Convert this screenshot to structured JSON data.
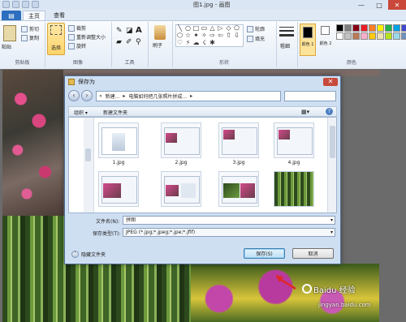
{
  "window": {
    "title": "图1.jpg - 画图",
    "controls": [
      "—",
      "□",
      "✕"
    ]
  },
  "tabs": {
    "home": "主页",
    "view": "查看"
  },
  "ribbon": {
    "clipboard": {
      "paste": "粘贴",
      "cut": "剪切",
      "copy": "复制",
      "label": "剪贴板"
    },
    "image": {
      "select": "选择",
      "crop": "裁剪",
      "resize": "重新调整大小",
      "rotate": "旋转",
      "label": "图像"
    },
    "tools": {
      "label": "工具"
    },
    "brushes": {
      "label": "刷子"
    },
    "shapes": {
      "outline": "轮廓",
      "fill": "填充",
      "label": "形状",
      "glyphs": [
        "╲",
        "○",
        "□",
        "▭",
        "△",
        "▷",
        "◇",
        "⬠",
        "⬡",
        "☆",
        "✦",
        "✧",
        "⇨",
        "⇦",
        "⇧",
        "⇩",
        "♡",
        "⚡",
        "☁",
        "☇",
        "✱"
      ]
    },
    "size": {
      "label": "粗细"
    },
    "colors": {
      "color1": "颜色 1",
      "color2": "颜色 2",
      "label": "颜色",
      "palette": [
        "#000000",
        "#7f7f7f",
        "#880015",
        "#ed1c24",
        "#ff7f27",
        "#fff200",
        "#22b14c",
        "#00a2e8",
        "#3f48cc",
        "#a349a4",
        "#ffffff",
        "#c3c3c3",
        "#b97a57",
        "#ffaec9",
        "#ffc90e",
        "#efe4b0",
        "#b5e61d",
        "#99d9ea",
        "#7092be",
        "#c8bfe7"
      ]
    }
  },
  "dialog": {
    "title": "保存为",
    "path": [
      "«",
      "新建...",
      "▸",
      "电脑如何把几张照片拼成...",
      "▸"
    ],
    "toolbar": {
      "organize": "组织 ▾",
      "new_folder": "新建文件夹"
    },
    "files": [
      "1.jpg",
      "2.jpg",
      "3.jpg",
      "4.jpg",
      "",
      "",
      "",
      ""
    ],
    "filename_label": "文件名(N):",
    "filename_value": "拼图",
    "filetype_label": "保存类型(T):",
    "filetype_value": "JPEG (*.jpg;*.jpeg;*.jpe;*.jfif)",
    "hide_folders": "隐藏文件夹",
    "save": "保存(S)",
    "cancel": "取消"
  },
  "watermark": {
    "brand": "Baidu 经验",
    "url": "jingyan.baidu.com"
  }
}
